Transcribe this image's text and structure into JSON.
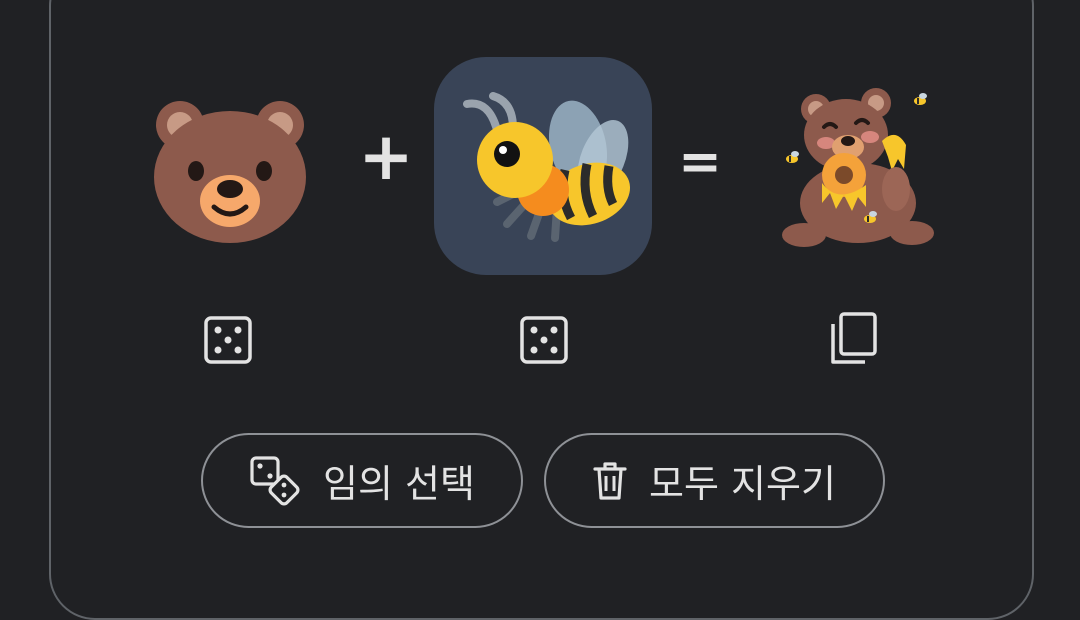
{
  "mixer": {
    "left_emoji": "bear",
    "middle_emoji": "honeybee",
    "result_emoji": "bear-with-honey-and-bees",
    "plus_sign": "+",
    "equals_sign": "="
  },
  "actions": {
    "randomize_icon": "dice-icon",
    "copy_icon": "copy-icon",
    "random_label": "임의 선택",
    "clear_label": "모두 지우기",
    "random_icon": "dice-pair-icon",
    "clear_icon": "trash-icon"
  },
  "colors": {
    "background": "#202124",
    "selected_slot": "#394457",
    "outline": "#8e9196",
    "text": "#e3e3e3"
  }
}
